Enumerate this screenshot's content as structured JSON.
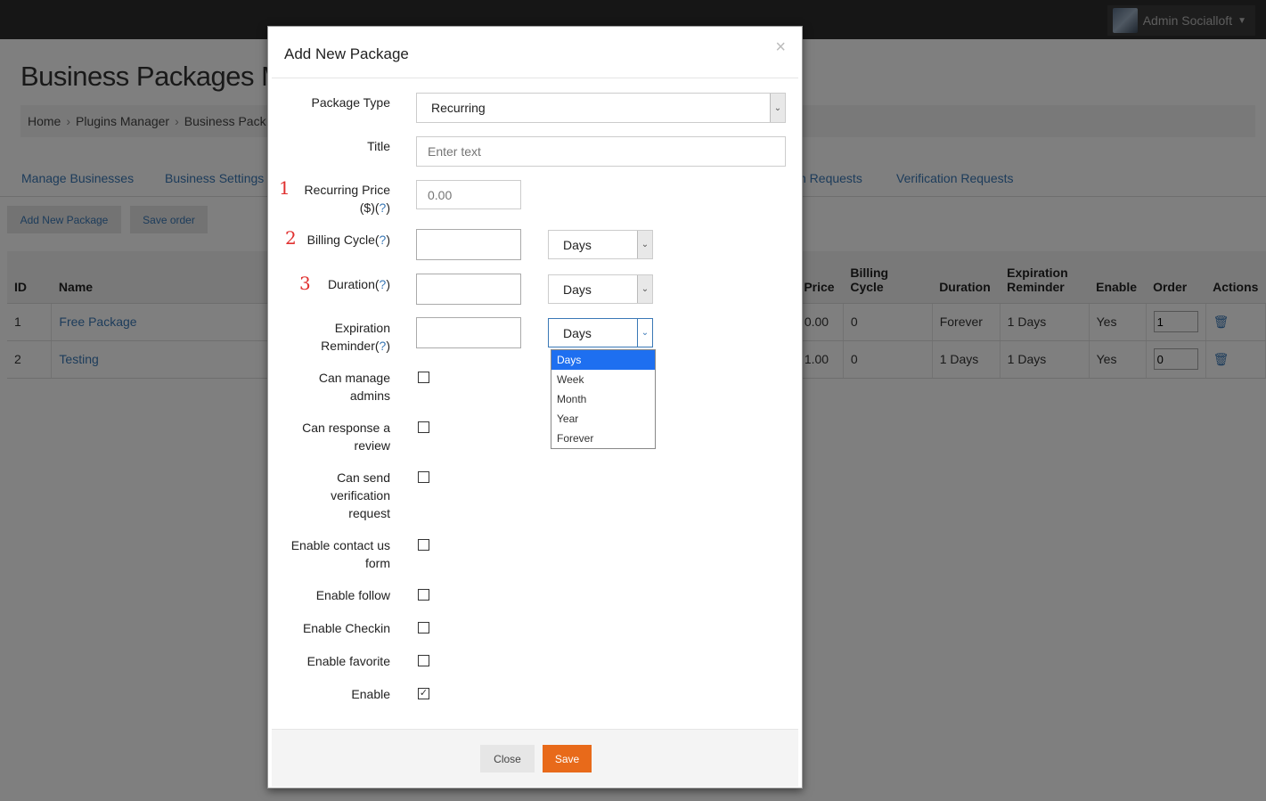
{
  "user": {
    "name": "Admin Socialloft"
  },
  "page": {
    "title": "Business Packages M"
  },
  "breadcrumb": [
    "Home",
    "Plugins Manager",
    "Business Pack"
  ],
  "tabs": [
    "Manage Businesses",
    "Business Settings",
    "n Requests",
    "Verification Requests"
  ],
  "buttons": {
    "add_new_package": "Add New Package",
    "save_order": "Save order"
  },
  "table": {
    "headers": {
      "id": "ID",
      "name": "Name",
      "price": "Price",
      "billing_cycle": "Billing Cycle",
      "duration": "Duration",
      "expiration_reminder": "Expiration Reminder",
      "enable": "Enable",
      "order": "Order",
      "actions": "Actions"
    },
    "rows": [
      {
        "id": "1",
        "name": "Free Package",
        "price": "0.00",
        "billing_cycle": "0",
        "duration": "Forever",
        "expiration_reminder": "1 Days",
        "enable": "Yes",
        "order": "1"
      },
      {
        "id": "2",
        "name": "Testing",
        "price": "1.00",
        "billing_cycle": "0",
        "duration": "1 Days",
        "expiration_reminder": "1 Days",
        "enable": "Yes",
        "order": "0"
      }
    ]
  },
  "modal": {
    "title": "Add New Package",
    "close_glyph": "×",
    "fields": {
      "package_type": {
        "label": "Package Type",
        "value": "Recurring"
      },
      "title": {
        "label": "Title",
        "placeholder": "Enter text"
      },
      "recurring_price": {
        "label_a": "Recurring Price",
        "label_b": "($)(",
        "label_q": "?",
        "label_end": ")",
        "placeholder": "0.00",
        "marker": "1"
      },
      "billing_cycle": {
        "label": "Billing Cycle(",
        "label_q": "?",
        "label_end": ")",
        "unit": "Days",
        "marker": "2"
      },
      "duration": {
        "label": "Duration(",
        "label_q": "?",
        "label_end": ")",
        "unit": "Days",
        "marker": "3"
      },
      "expiration_reminder": {
        "label_a": "Expiration",
        "label_b": "Reminder(",
        "label_q": "?",
        "label_end": ")",
        "unit": "Days"
      }
    },
    "unit_options": [
      "Days",
      "Week",
      "Month",
      "Year",
      "Forever"
    ],
    "checkboxes": [
      {
        "label_lines": [
          "Can manage",
          "admins"
        ],
        "checked": false
      },
      {
        "label_lines": [
          "Can response a",
          "review"
        ],
        "checked": false
      },
      {
        "label_lines": [
          "Can send",
          "verification",
          "request"
        ],
        "checked": false
      },
      {
        "label_lines": [
          "Enable contact us",
          "form"
        ],
        "checked": false
      },
      {
        "label_lines": [
          "Enable follow"
        ],
        "checked": false
      },
      {
        "label_lines": [
          "Enable Checkin"
        ],
        "checked": false
      },
      {
        "label_lines": [
          "Enable favorite"
        ],
        "checked": false
      },
      {
        "label_lines": [
          "Enable"
        ],
        "checked": true
      }
    ],
    "footer": {
      "close": "Close",
      "save": "Save"
    }
  }
}
